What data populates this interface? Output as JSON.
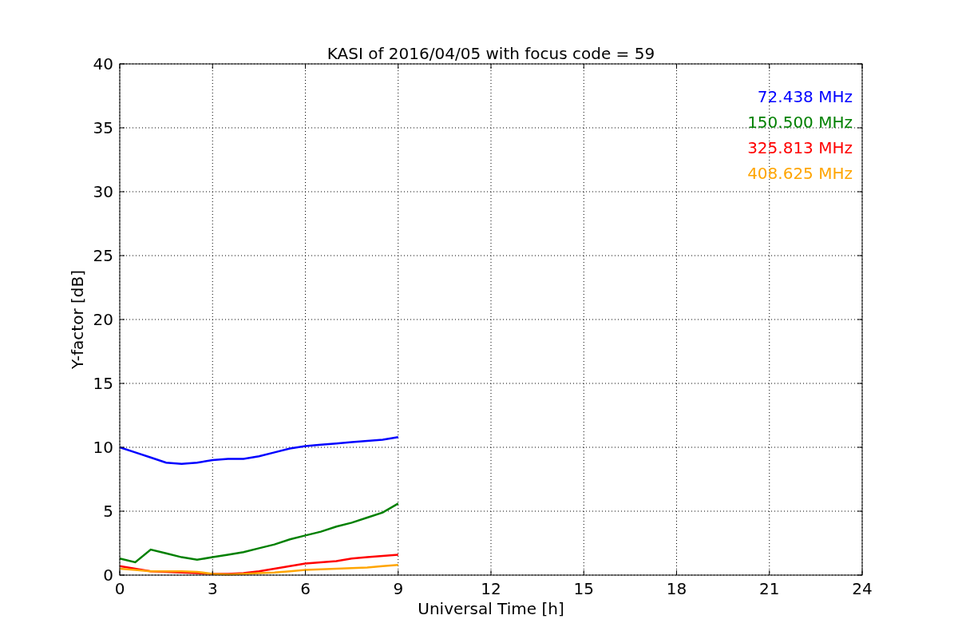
{
  "chart_data": {
    "type": "line",
    "title": "KASI of 2016/04/05 with focus code = 59",
    "xlabel": "Universal Time [h]",
    "ylabel": "Y-factor [dB]",
    "x": [
      0,
      0.5,
      1,
      1.5,
      2,
      2.5,
      3,
      3.5,
      4,
      4.5,
      5,
      5.5,
      6,
      6.5,
      7,
      7.5,
      8,
      8.5,
      9
    ],
    "series": [
      {
        "name": "72.438 MHz",
        "color": "#0000ff",
        "values": [
          10,
          9.6,
          9.2,
          8.8,
          8.7,
          8.8,
          9.0,
          9.1,
          9.1,
          9.3,
          9.6,
          9.9,
          10.1,
          10.2,
          10.3,
          10.4,
          10.5,
          10.6,
          10.8
        ]
      },
      {
        "name": "150.500 MHz",
        "color": "#008000",
        "values": [
          1.3,
          1.0,
          2.0,
          1.7,
          1.4,
          1.2,
          1.4,
          1.6,
          1.8,
          2.1,
          2.4,
          2.8,
          3.1,
          3.4,
          3.8,
          4.1,
          4.5,
          4.9,
          5.6
        ]
      },
      {
        "name": "325.813 MHz",
        "color": "#ff0000",
        "values": [
          0.7,
          0.5,
          0.3,
          0.25,
          0.2,
          0.15,
          0.1,
          0.1,
          0.15,
          0.3,
          0.5,
          0.7,
          0.9,
          1.0,
          1.1,
          1.3,
          1.4,
          1.5,
          1.6
        ]
      },
      {
        "name": "408.625 MHz",
        "color": "#ffa500",
        "values": [
          0.5,
          0.4,
          0.3,
          0.3,
          0.3,
          0.25,
          0.1,
          0.05,
          0.1,
          0.15,
          0.2,
          0.3,
          0.4,
          0.45,
          0.5,
          0.55,
          0.6,
          0.7,
          0.8
        ]
      }
    ],
    "grid": true,
    "xlim": [
      0,
      24
    ],
    "ylim": [
      0,
      40
    ],
    "xticks": [
      0,
      3,
      6,
      9,
      12,
      15,
      18,
      21,
      24
    ],
    "yticks": [
      0,
      5,
      10,
      15,
      20,
      25,
      30,
      35,
      40
    ]
  }
}
